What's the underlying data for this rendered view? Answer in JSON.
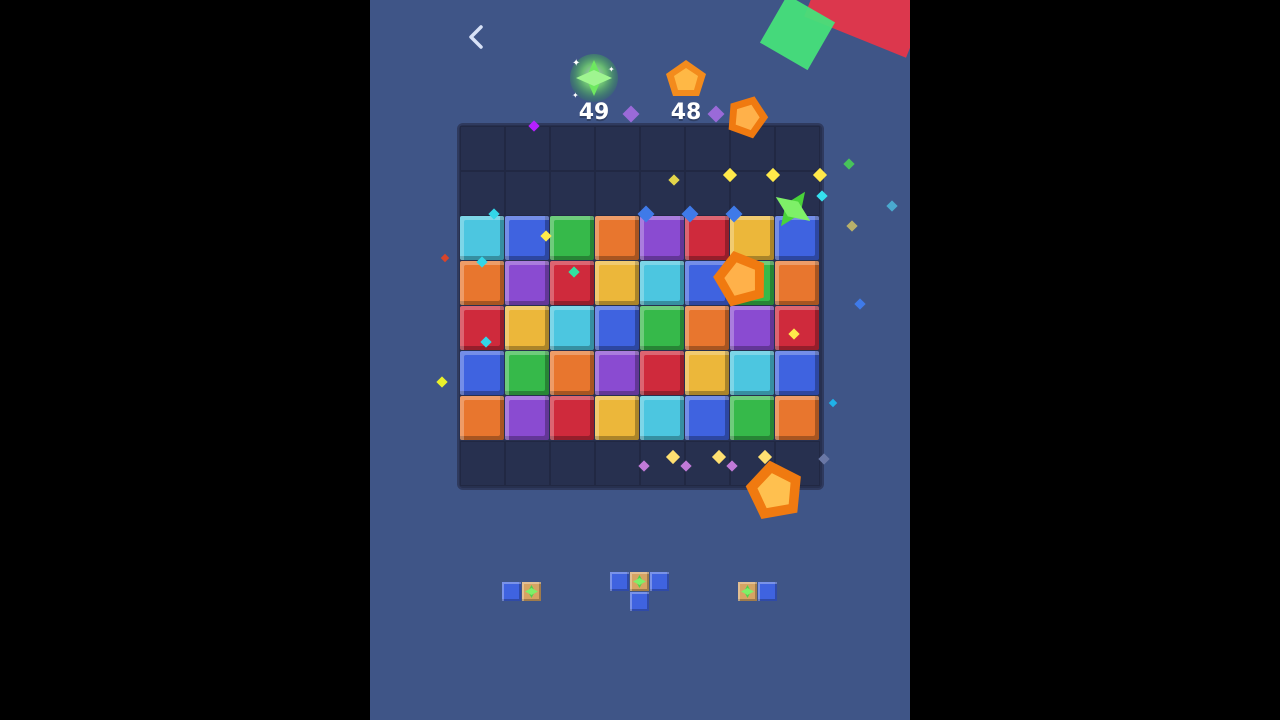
{
  "hud": {
    "green_gem_remaining": "49",
    "orange_gem_remaining": "48"
  },
  "icons": {
    "back": "chevron-left-icon",
    "goal_1": "green-gem-icon",
    "goal_2": "orange-pentagon-gem-icon"
  },
  "colors": {
    "background": "#3f5587",
    "board": "#27304f",
    "cyan": "#4cc6e0",
    "blue": "#3f63e0",
    "green": "#36b94a",
    "orange": "#e8762e",
    "purple": "#8a4bd1",
    "red": "#cf2a3c",
    "yellow": "#ecb73a"
  },
  "board": {
    "rows": [
      [
        "empty",
        "empty",
        "empty",
        "empty",
        "empty",
        "empty",
        "empty",
        "empty"
      ],
      [
        "empty",
        "empty",
        "empty",
        "empty",
        "empty",
        "empty",
        "empty",
        "empty"
      ],
      [
        "cyan",
        "blue",
        "green",
        "orange",
        "purple",
        "red",
        "yellow",
        "blue"
      ],
      [
        "orange",
        "purple",
        "red",
        "yellow",
        "cyan",
        "blue",
        "green",
        "orange"
      ],
      [
        "red",
        "yellow",
        "cyan",
        "blue",
        "green",
        "orange",
        "purple",
        "red"
      ],
      [
        "blue",
        "green",
        "orange",
        "purple",
        "red",
        "yellow",
        "cyan",
        "blue"
      ],
      [
        "orange",
        "purple",
        "red",
        "yellow",
        "cyan",
        "blue",
        "green",
        "orange"
      ],
      [
        "empty",
        "empty",
        "empty",
        "empty",
        "empty",
        "empty",
        "empty",
        "empty"
      ]
    ]
  },
  "pieces": [
    {
      "name": "piece-1",
      "cells": [
        [
          "blue",
          "gem"
        ]
      ]
    },
    {
      "name": "piece-2",
      "cells": [
        [
          "blue",
          "gem",
          "blue"
        ],
        [
          "",
          "blue",
          ""
        ]
      ]
    },
    {
      "name": "piece-3",
      "cells": [
        [
          "gem",
          "blue"
        ]
      ]
    }
  ]
}
